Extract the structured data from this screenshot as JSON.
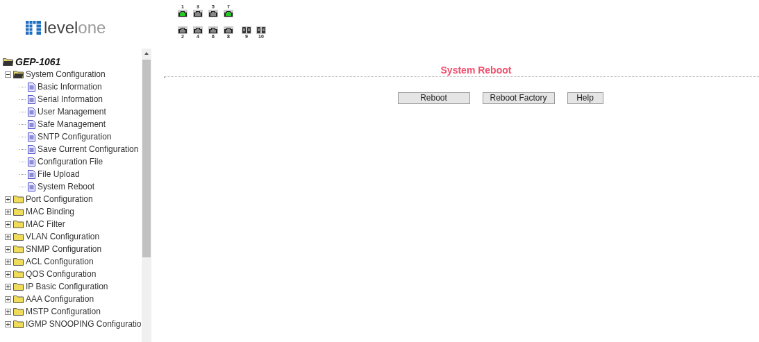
{
  "logo": {
    "text_1": "level",
    "text_2": "one"
  },
  "port_rows": [
    [
      {
        "label": "1",
        "kind": "rj45",
        "link": true
      },
      {
        "label": "3",
        "kind": "rj45",
        "link": false
      },
      {
        "label": "5",
        "kind": "rj45",
        "link": false
      },
      {
        "label": "7",
        "kind": "rj45",
        "link": true
      }
    ],
    [
      {
        "label": "2",
        "kind": "rj45",
        "link": false
      },
      {
        "label": "4",
        "kind": "rj45",
        "link": false
      },
      {
        "label": "6",
        "kind": "rj45",
        "link": false
      },
      {
        "label": "8",
        "kind": "rj45",
        "link": false
      },
      {
        "label": "9",
        "kind": "sfp",
        "link": false
      },
      {
        "label": "10",
        "kind": "sfp",
        "link": false
      }
    ]
  ],
  "tree": {
    "root": "GEP-1061",
    "items": [
      {
        "label": "System Configuration",
        "expanded": true,
        "children": [
          {
            "label": "Basic Information"
          },
          {
            "label": "Serial Information"
          },
          {
            "label": "User Management"
          },
          {
            "label": "Safe Management"
          },
          {
            "label": "SNTP Configuration"
          },
          {
            "label": "Save Current Configuration"
          },
          {
            "label": "Configuration File"
          },
          {
            "label": "File Upload"
          },
          {
            "label": "System Reboot"
          }
        ]
      },
      {
        "label": "Port Configuration",
        "expanded": false
      },
      {
        "label": "MAC Binding",
        "expanded": false
      },
      {
        "label": "MAC Filter",
        "expanded": false
      },
      {
        "label": "VLAN Configuration",
        "expanded": false
      },
      {
        "label": "SNMP Configuration",
        "expanded": false
      },
      {
        "label": "ACL Configuration",
        "expanded": false
      },
      {
        "label": "QOS Configuration",
        "expanded": false
      },
      {
        "label": "IP Basic Configuration",
        "expanded": false
      },
      {
        "label": "AAA Configuration",
        "expanded": false
      },
      {
        "label": "MSTP Configuration",
        "expanded": false
      },
      {
        "label": "IGMP SNOOPING Configuratio",
        "expanded": false
      }
    ]
  },
  "main": {
    "title": "System Reboot",
    "buttons": [
      "Reboot",
      "Reboot Factory",
      "Help"
    ]
  }
}
